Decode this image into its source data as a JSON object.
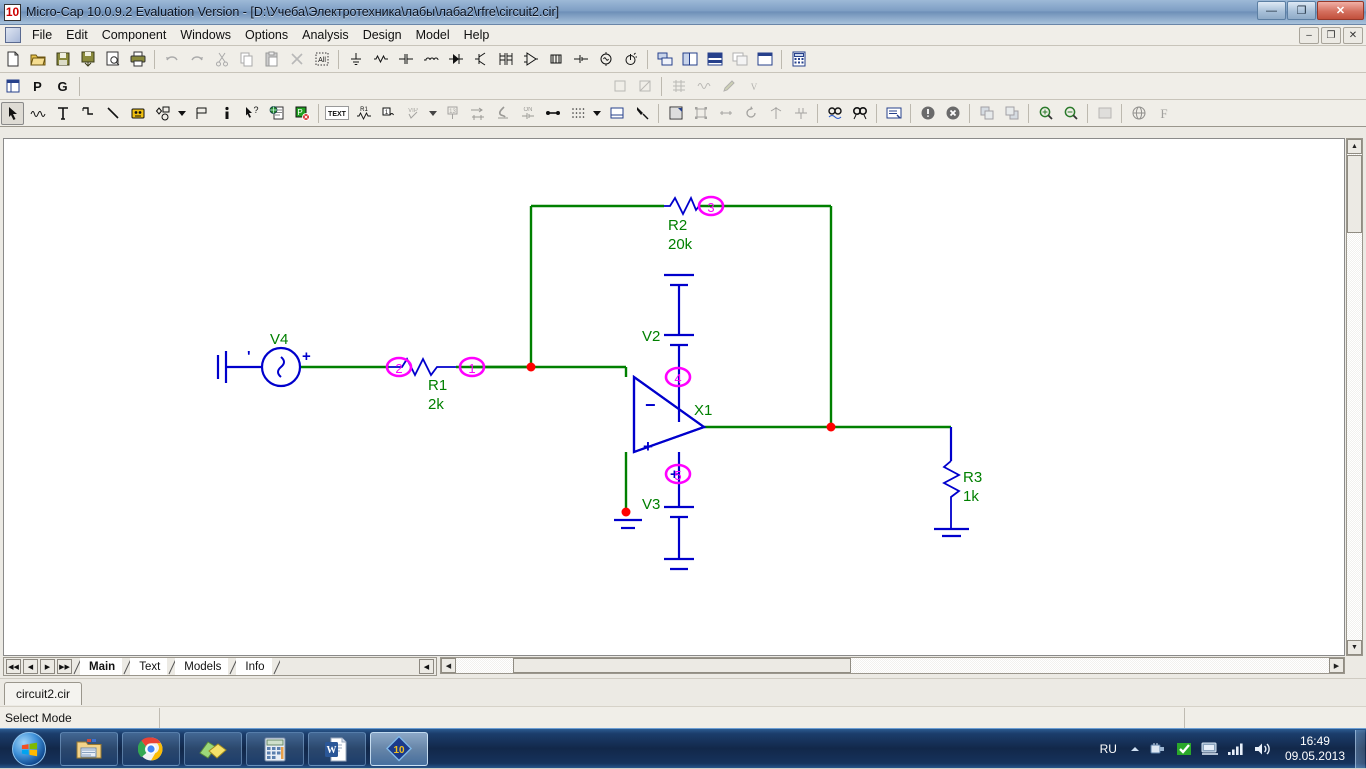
{
  "window": {
    "title": "Micro-Cap 10.0.9.2 Evaluation Version - [D:\\Учеба\\Электротехника\\лабы\\лаба2\\rfre\\circuit2.cir]",
    "logo_text": "10",
    "minimize_label": "—",
    "maximize_label": "❐",
    "close_label": "✕"
  },
  "mdi": {
    "minimize_label": "–",
    "restore_label": "❐",
    "close_label": "✕"
  },
  "menu": {
    "items": [
      {
        "label": "File"
      },
      {
        "label": "Edit"
      },
      {
        "label": "Component"
      },
      {
        "label": "Windows"
      },
      {
        "label": "Options"
      },
      {
        "label": "Analysis"
      },
      {
        "label": "Design"
      },
      {
        "label": "Model"
      },
      {
        "label": "Help"
      }
    ]
  },
  "toolbar_file": {
    "buttons": [
      {
        "name": "new-file-icon",
        "title": "New"
      },
      {
        "name": "open-file-icon",
        "title": "Open"
      },
      {
        "name": "save-file-icon",
        "title": "Save"
      },
      {
        "name": "save-as-icon",
        "title": "Save As"
      },
      {
        "name": "print-preview-icon",
        "title": "Print Preview"
      },
      {
        "name": "print-icon",
        "title": "Print"
      },
      {
        "name": "undo-icon",
        "title": "Undo"
      },
      {
        "name": "redo-icon",
        "title": "Redo"
      },
      {
        "name": "cut-icon",
        "title": "Cut"
      },
      {
        "name": "copy-icon",
        "title": "Copy"
      },
      {
        "name": "paste-icon",
        "title": "Paste"
      },
      {
        "name": "delete-icon",
        "title": "Delete"
      },
      {
        "name": "select-all-icon",
        "title": "Select All"
      },
      {
        "name": "ground-icon",
        "title": "Ground"
      },
      {
        "name": "resistor-icon",
        "title": "Resistor"
      },
      {
        "name": "capacitor-icon",
        "title": "Capacitor"
      },
      {
        "name": "inductor-icon",
        "title": "Inductor"
      },
      {
        "name": "diode-icon",
        "title": "Diode"
      },
      {
        "name": "transistor-icon",
        "title": "Transistor"
      },
      {
        "name": "transformer-icon",
        "title": "Transformer"
      },
      {
        "name": "opamp-icon",
        "title": "Op Amp"
      },
      {
        "name": "battery-icon",
        "title": "Battery"
      },
      {
        "name": "pulse-source-icon",
        "title": "Pulse Source"
      },
      {
        "name": "sine-source-icon",
        "title": "Sine Source"
      },
      {
        "name": "ac-source-icon",
        "title": "AC Source"
      },
      {
        "name": "tile-windows-icon",
        "title": "Tile"
      },
      {
        "name": "tile-vertical-icon",
        "title": "Tile Vertical"
      },
      {
        "name": "tile-horizontal-icon",
        "title": "Tile Horizontal"
      },
      {
        "name": "cascade-icon",
        "title": "Cascade"
      },
      {
        "name": "maximize-window-icon",
        "title": "Maximize"
      },
      {
        "name": "calculator-icon",
        "title": "Calculator"
      }
    ]
  },
  "toolbar_page": {
    "window_icon": "window-icon",
    "p_label": "P",
    "g_label": "G"
  },
  "toolbar_draw": {
    "buttons": [
      {
        "name": "select-arrow-icon",
        "title": "Select Mode",
        "selected": true
      },
      {
        "name": "wire-icon",
        "title": "Wire Mode"
      },
      {
        "name": "text-icon",
        "title": "Text"
      },
      {
        "name": "orthogonal-wire-icon",
        "title": "Orthogonal Wire"
      },
      {
        "name": "diagonal-line-icon",
        "title": "Line"
      },
      {
        "name": "component-bus-icon",
        "title": "Bus"
      },
      {
        "name": "shapes-icon",
        "title": "Graphic Shapes"
      },
      {
        "name": "shapes-dropdown-icon",
        "title": "Shapes Menu"
      },
      {
        "name": "flag-icon",
        "title": "Flag"
      },
      {
        "name": "info-pin-icon",
        "title": "Info"
      },
      {
        "name": "help-pointer-icon",
        "title": "Help"
      },
      {
        "name": "clipboard-globe-icon",
        "title": "Paste From Web"
      },
      {
        "name": "stop-component-icon",
        "title": "Disable"
      },
      {
        "name": "text-attribute-icon",
        "title": "TEXT"
      },
      {
        "name": "part-name-icon",
        "title": "Part Name"
      },
      {
        "name": "node-number-icon",
        "title": "Node Numbers"
      },
      {
        "name": "node-voltage-icon",
        "title": "Node Voltages"
      },
      {
        "name": "node-voltage-dropdown-icon",
        "title": "Voltages Menu"
      },
      {
        "name": "grid-text-icon",
        "title": "Grid Text"
      },
      {
        "name": "current-arrow-icon",
        "title": "Currents"
      },
      {
        "name": "power-icon",
        "title": "Power"
      },
      {
        "name": "condition-icon",
        "title": "Conditions"
      },
      {
        "name": "pin-connection-icon",
        "title": "Pin Connections"
      },
      {
        "name": "grid-dots-icon",
        "title": "Grid"
      },
      {
        "name": "grid-dropdown-icon",
        "title": "Grid Menu"
      },
      {
        "name": "border-icon",
        "title": "Border"
      },
      {
        "name": "title-block-icon",
        "title": "Title Block"
      },
      {
        "name": "properties-icon",
        "title": "Properties"
      },
      {
        "name": "rotate-box-icon",
        "title": "Rotate"
      },
      {
        "name": "mirror-icon",
        "title": "Mirror"
      },
      {
        "name": "rotate-ccw-icon",
        "title": "Rotate CCW"
      },
      {
        "name": "flip-x-icon",
        "title": "Flip X"
      },
      {
        "name": "flip-y-icon",
        "title": "Flip Y"
      },
      {
        "name": "find-icon",
        "title": "Find"
      },
      {
        "name": "find-component-icon",
        "title": "Find Component"
      },
      {
        "name": "model-editor-icon",
        "title": "Model Editor"
      },
      {
        "name": "warning-icon",
        "title": "Warnings"
      },
      {
        "name": "error-icon",
        "title": "Errors"
      },
      {
        "name": "bring-front-icon",
        "title": "Bring To Front"
      },
      {
        "name": "send-back-icon",
        "title": "Send To Back"
      },
      {
        "name": "zoom-in-icon",
        "title": "Zoom In"
      },
      {
        "name": "zoom-out-icon",
        "title": "Zoom Out"
      },
      {
        "name": "page-thumbnail-icon",
        "title": "Pages"
      },
      {
        "name": "globe-icon",
        "title": "Web"
      },
      {
        "name": "font-icon",
        "title": "Font"
      }
    ]
  },
  "schematic": {
    "colors": {
      "wire": "#008000",
      "component": "#0000cc",
      "label": "#008000",
      "node_number": "#ff00ff",
      "junction": "#ff0000",
      "background": "#ffffff"
    },
    "components": [
      {
        "id": "V4",
        "name": "V4",
        "type": "sine-source",
        "value": ""
      },
      {
        "id": "R1",
        "name": "R1",
        "type": "resistor",
        "value": "2k"
      },
      {
        "id": "R2",
        "name": "R2",
        "type": "resistor",
        "value": "20k"
      },
      {
        "id": "R3",
        "name": "R3",
        "type": "resistor",
        "value": "1k"
      },
      {
        "id": "V2",
        "name": "V2",
        "type": "battery",
        "value": ""
      },
      {
        "id": "V3",
        "name": "V3",
        "type": "battery",
        "value": ""
      },
      {
        "id": "X1",
        "name": "X1",
        "type": "opamp",
        "value": ""
      }
    ],
    "node_numbers": [
      "1",
      "2",
      "3",
      "4",
      "5"
    ],
    "opamp_pins": {
      "inverting": "−",
      "noninverting": "+"
    },
    "source_polarity": {
      "plus": "+",
      "minus": "'"
    }
  },
  "sheet_tabs": {
    "nav": [
      {
        "name": "first-page-button",
        "glyph": "◀◀"
      },
      {
        "name": "prev-page-button",
        "glyph": "◀"
      },
      {
        "name": "next-page-button",
        "glyph": "▶"
      },
      {
        "name": "last-page-button",
        "glyph": "▶▶"
      }
    ],
    "tabs": [
      {
        "label": "Main",
        "active": true
      },
      {
        "label": "Text",
        "active": false
      },
      {
        "label": "Models",
        "active": false
      },
      {
        "label": "Info",
        "active": false
      }
    ]
  },
  "doc_tabs": {
    "tabs": [
      {
        "label": "circuit2.cir",
        "active": true
      }
    ]
  },
  "status_bar": {
    "mode": "Select Mode",
    "secondary": ""
  },
  "taskbar": {
    "start_label": "Start",
    "tasks": [
      {
        "name": "taskbar-explorer",
        "label": "Windows Explorer",
        "active": false
      },
      {
        "name": "taskbar-chrome",
        "label": "Google Chrome",
        "active": false
      },
      {
        "name": "taskbar-sticky-notes",
        "label": "Sticky Notes",
        "active": false
      },
      {
        "name": "taskbar-calculator",
        "label": "Calculator",
        "active": false
      },
      {
        "name": "taskbar-word",
        "label": "Microsoft Word",
        "active": false
      },
      {
        "name": "taskbar-microcap",
        "label": "Micro-Cap 10",
        "active": true
      }
    ],
    "tray": {
      "language": "RU",
      "icons": [
        {
          "name": "show-hidden-icons-icon"
        },
        {
          "name": "hardware-safe-removal-icon"
        },
        {
          "name": "antivirus-icon"
        },
        {
          "name": "network-icon"
        },
        {
          "name": "signal-icon"
        },
        {
          "name": "volume-icon"
        }
      ],
      "time": "16:49",
      "date": "09.05.2013"
    }
  }
}
